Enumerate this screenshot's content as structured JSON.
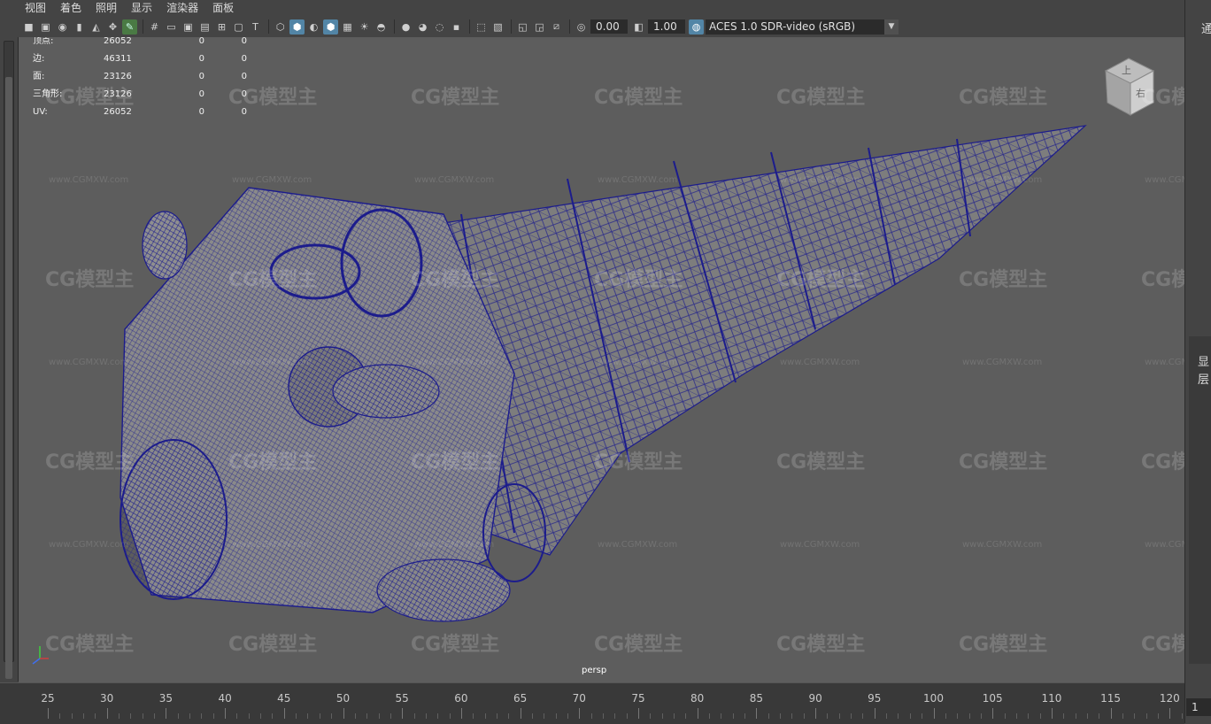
{
  "menu": [
    "视图",
    "着色",
    "照明",
    "显示",
    "渲染器",
    "面板"
  ],
  "toolbar": {
    "exposure_value": "0.00",
    "gamma_value": "1.00",
    "color_space": "ACES 1.0 SDR-video (sRGB)"
  },
  "hud": {
    "rows": [
      {
        "label": "顶点:",
        "v1": "26052",
        "v2": "0",
        "v3": "0"
      },
      {
        "label": "边:",
        "v1": "46311",
        "v2": "0",
        "v3": "0"
      },
      {
        "label": "面:",
        "v1": "23126",
        "v2": "0",
        "v3": "0"
      },
      {
        "label": "三角形:",
        "v1": "23126",
        "v2": "0",
        "v3": "0"
      },
      {
        "label": "UV:",
        "v1": "26052",
        "v2": "0",
        "v3": "0"
      }
    ]
  },
  "viewport": {
    "camera_label": "persp",
    "view_cube_labels": [
      "上",
      "右"
    ]
  },
  "watermark": {
    "brand": "CG模型主",
    "url": "www.CGMXW.com"
  },
  "right_panel": {
    "chars": [
      "通",
      "显",
      "层"
    ]
  },
  "timeline": {
    "ticks": [
      "25",
      "30",
      "35",
      "40",
      "45",
      "50",
      "55",
      "60",
      "65",
      "70",
      "75",
      "80",
      "85",
      "90",
      "95",
      "100",
      "105",
      "110",
      "115",
      "120"
    ],
    "current_frame": "1"
  },
  "colors": {
    "accent": "#5285a6",
    "wire": "#1c1c8c",
    "viewport_bg": "#5d5d5d"
  }
}
